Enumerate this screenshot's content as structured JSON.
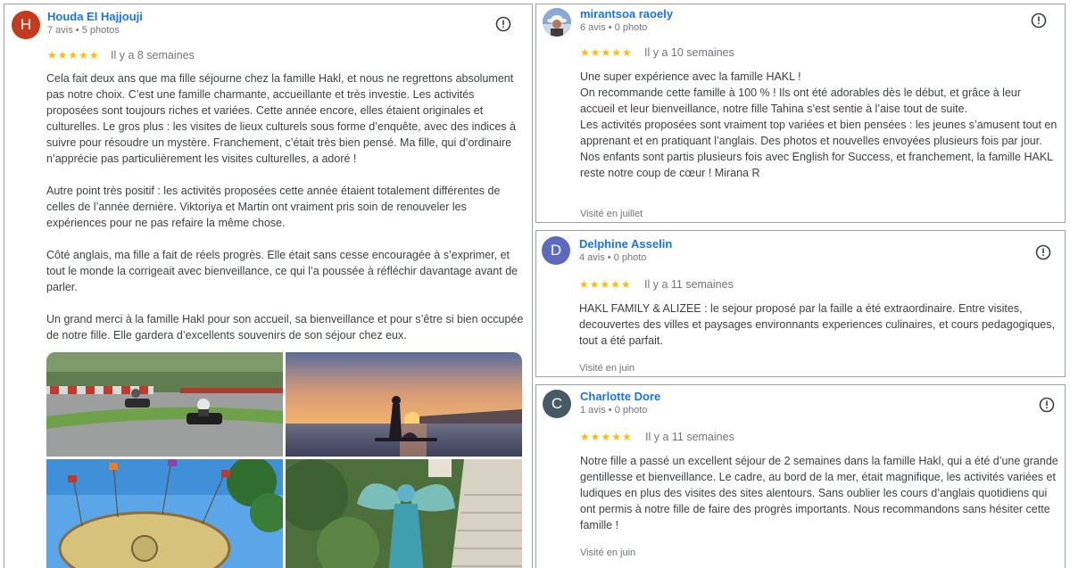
{
  "reviews": [
    {
      "author": "Houda El Hajjouji",
      "avatar_letter": "H",
      "avatar_color": "#c5391c",
      "meta": "7 avis • 5 photos",
      "stars": "★★★★★",
      "date": "Il y a 8 semaines",
      "paragraphs": [
        "Cela fait deux ans que ma fille séjourne chez la famille Hakl, et nous ne regrettons absolument pas notre choix. C’est une famille charmante, accueillante et très investie. Les activités proposées sont toujours riches et variées. Cette année encore, elles étaient originales et culturelles. Le gros plus : les visites de lieux culturels sous forme d’enquête, avec des indices à suivre pour résoudre un mystère. Franchement, c’était très bien pensé. Ma fille, qui d’ordinaire n’apprécie pas particulièrement les visites culturelles, a adoré !",
        "Autre point très positif : les activités proposées cette année étaient totalement différentes de celles de l’année dernière. Viktoriya et Martin ont vraiment pris soin de renouveler les expériences pour ne pas refaire la même chose.",
        "Côté anglais, ma fille a fait de réels progrès. Elle était sans cesse encouragée à s’exprimer, et tout le monde la corrigeait avec bienveillance, ce qui l’a poussée à réfléchir davantage avant de parler.",
        "Un grand merci à la famille Hakl pour son accueil, sa bienveillance et pour s’être si bien occupée de notre fille. Elle gardera d’excellents souvenirs de son séjour chez eux."
      ],
      "photo_icons": [
        "go-kart-photo",
        "sunset-paddle-photo",
        "fairground-ride-photo",
        "fairy-costume-photo"
      ]
    },
    {
      "author": "mirantsoa raoely",
      "avatar_icon": "profile-photo",
      "meta": "6 avis • 0 photo",
      "stars": "★★★★★",
      "date": "Il y a 10 semaines",
      "lines": [
        "Une super expérience avec la famille HAKL !",
        "On recommande cette famille à 100 % ! Ils ont été adorables dès le début, et grâce à leur accueil et leur bienveillance, notre fille Tahina s’est sentie à l’aise tout de suite.",
        "Les activités proposées sont vraiment top variées et bien pensées : les jeunes s’amusent tout en apprenant et en pratiquant l’anglais. Des photos et nouvelles envoyées plusieurs fois par jour.",
        "Nos enfants sont partis plusieurs fois avec English for Success, et franchement, la famille HAKL reste notre coup de cœur ! Mirana R"
      ],
      "visited": "Visité en juillet"
    },
    {
      "author": "Delphine Asselin",
      "avatar_letter": "D",
      "avatar_color": "#5c6bc0",
      "meta": "4 avis • 0 photo",
      "stars": "★★★★★",
      "date": "Il y a 11 semaines",
      "text": "HAKL FAMILY & ALIZEE : le sejour proposé par la faille a été extraordinaire. Entre visites, decouvertes des villes et paysages environnants experiences culinaires, et cours pedagogiques, tout a été parfait.",
      "visited": "Visité en juin"
    },
    {
      "author": "Charlotte Dore",
      "avatar_letter": "C",
      "avatar_color": "#455a64",
      "meta": "1 avis • 0 photo",
      "stars": "★★★★★",
      "date": "Il y a 11 semaines",
      "text": "Notre fille a passé un excellent séjour de 2 semaines dans la famille Hakl, qui a été d’une grande gentillesse et bienveillance. Le cadre, au bord de la mer, était magnifique, les activités variées et ludiques en plus des visites des sites alentours. Sans oublier les cours d’anglais quotidiens qui ont permis à notre fille de faire des progrès importants. Nous recommandons sans hésiter cette famille !",
      "visited": "Visité en juin"
    }
  ],
  "more_icon": "exclamation-circle-icon",
  "colors": {
    "author_link": "#1a73e8",
    "star": "#fbbc04",
    "muted": "#70757a",
    "border": "#9aa0a6"
  }
}
